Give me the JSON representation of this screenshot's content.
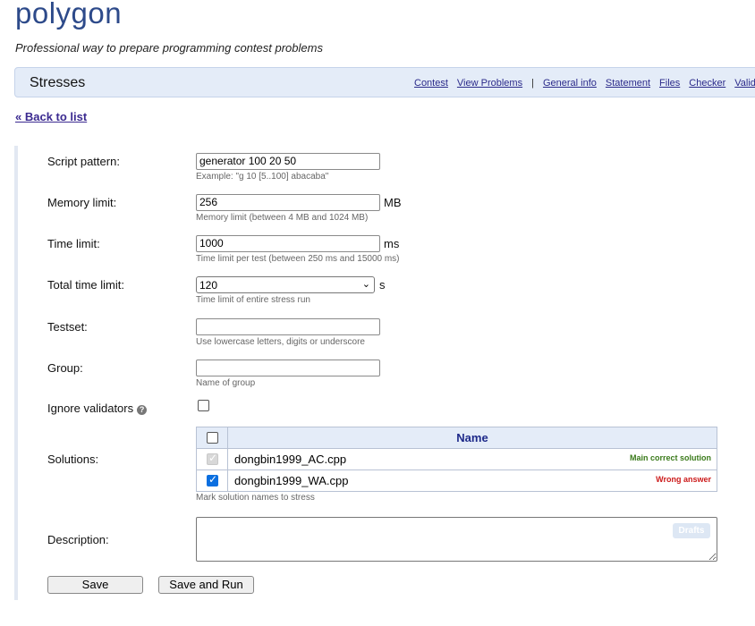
{
  "brand": {
    "logo": "polygon",
    "tagline": "Professional way to prepare programming contest problems"
  },
  "topbar": {
    "title": "Stresses",
    "nav": [
      "Contest",
      "View Problems"
    ],
    "nav_separator": "|",
    "nav_right": [
      "General info",
      "Statement",
      "Files",
      "Checker",
      "Valid"
    ]
  },
  "back_link": "« Back to list",
  "form": {
    "script_pattern": {
      "label": "Script pattern:",
      "value": "generator 100 20 50",
      "hint": "Example: \"g 10 [5..100] abacaba\""
    },
    "memory_limit": {
      "label": "Memory limit:",
      "value": "256",
      "unit": "MB",
      "hint": "Memory limit (between 4 MB and 1024 MB)"
    },
    "time_limit": {
      "label": "Time limit:",
      "value": "1000",
      "unit": "ms",
      "hint": "Time limit per test (between 250 ms and 15000 ms)"
    },
    "total_time_limit": {
      "label": "Total time limit:",
      "value": "120",
      "unit": "s",
      "hint": "Time limit of entire stress run"
    },
    "testset": {
      "label": "Testset:",
      "value": "",
      "hint": "Use lowercase letters, digits or underscore"
    },
    "group": {
      "label": "Group:",
      "value": "",
      "hint": "Name of group"
    },
    "ignore_validators": {
      "label": "Ignore validators",
      "help_icon": "question-circle-icon",
      "checked": false
    },
    "solutions": {
      "label": "Solutions:",
      "header": "Name",
      "rows": [
        {
          "name": "dongbin1999_AC.cpp",
          "tag": "Main correct solution",
          "checked": true,
          "disabled": true
        },
        {
          "name": "dongbin1999_WA.cpp",
          "tag": "Wrong answer",
          "checked": true,
          "disabled": false
        }
      ],
      "hint": "Mark solution names to stress"
    },
    "description": {
      "label": "Description:",
      "value": "",
      "drafts_label": "Drafts"
    }
  },
  "buttons": {
    "save": "Save",
    "save_and_run": "Save and Run"
  },
  "colors": {
    "logo": "#2d4a8a",
    "topbar_bg": "#e4ecf8",
    "main_tag": "#3a7a1a",
    "wrong_tag": "#cc1a1a",
    "checkbox_checked": "#0b6fe0"
  }
}
